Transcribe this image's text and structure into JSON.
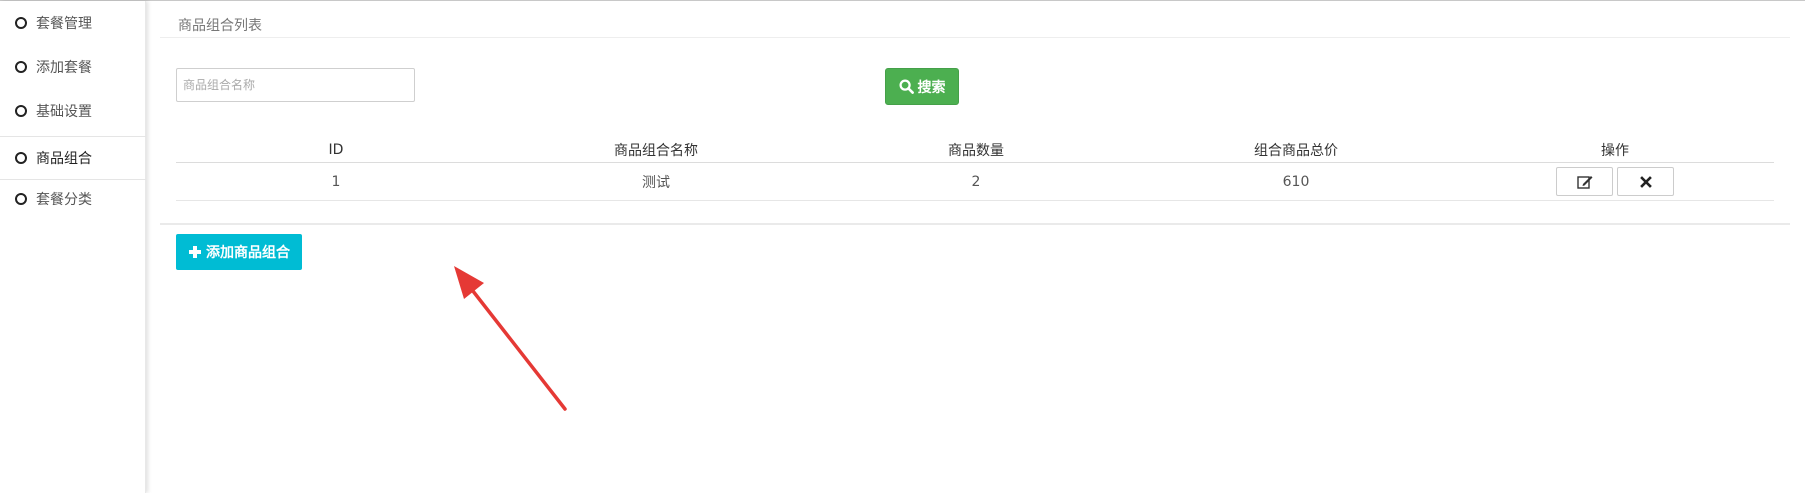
{
  "sidebar": {
    "items": [
      {
        "label": "套餐管理",
        "active": false
      },
      {
        "label": "添加套餐",
        "active": false
      },
      {
        "label": "基础设置",
        "active": false
      },
      {
        "label": "商品组合",
        "active": true
      },
      {
        "label": "套餐分类",
        "active": false
      }
    ]
  },
  "main": {
    "panel_title": "商品组合列表",
    "search": {
      "placeholder": "商品组合名称",
      "value": "",
      "button_label": "搜索",
      "button_icon": "search-icon"
    },
    "table": {
      "headers": [
        "ID",
        "商品组合名称",
        "商品数量",
        "组合商品总价",
        "操作"
      ],
      "rows": [
        {
          "id": "1",
          "name": "测试",
          "count": "2",
          "total": "610"
        }
      ]
    },
    "add_button_label": "添加商品组合"
  },
  "colors": {
    "accent_green": "#4caf50",
    "accent_cyan": "#00bcd4",
    "arrow_red": "#e53935"
  }
}
